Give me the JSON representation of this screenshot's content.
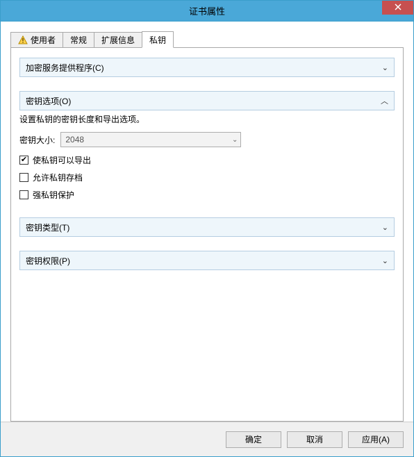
{
  "window": {
    "title": "证书属性"
  },
  "tabs": {
    "user": "使用者",
    "general": "常规",
    "ext": "扩展信息",
    "private": "私钥",
    "active": "private"
  },
  "sections": {
    "csp": {
      "title": "加密服务提供程序(C)"
    },
    "keyopts": {
      "title": "密钥选项(O)",
      "desc": "设置私钥的密钥长度和导出选项。",
      "keysize_label": "密钥大小:",
      "keysize_value": "2048",
      "exportable": "使私钥可以导出",
      "archive": "允许私钥存档",
      "strong": "强私钥保护"
    },
    "keytype": {
      "title": "密钥类型(T)"
    },
    "keyperm": {
      "title": "密钥权限(P)"
    }
  },
  "checks": {
    "exportable": true,
    "archive": false,
    "strong": false
  },
  "buttons": {
    "ok": "确定",
    "cancel": "取消",
    "apply": "应用(A)"
  },
  "glyphs": {
    "down": "⌄",
    "up": "︿",
    "check": "✔"
  }
}
